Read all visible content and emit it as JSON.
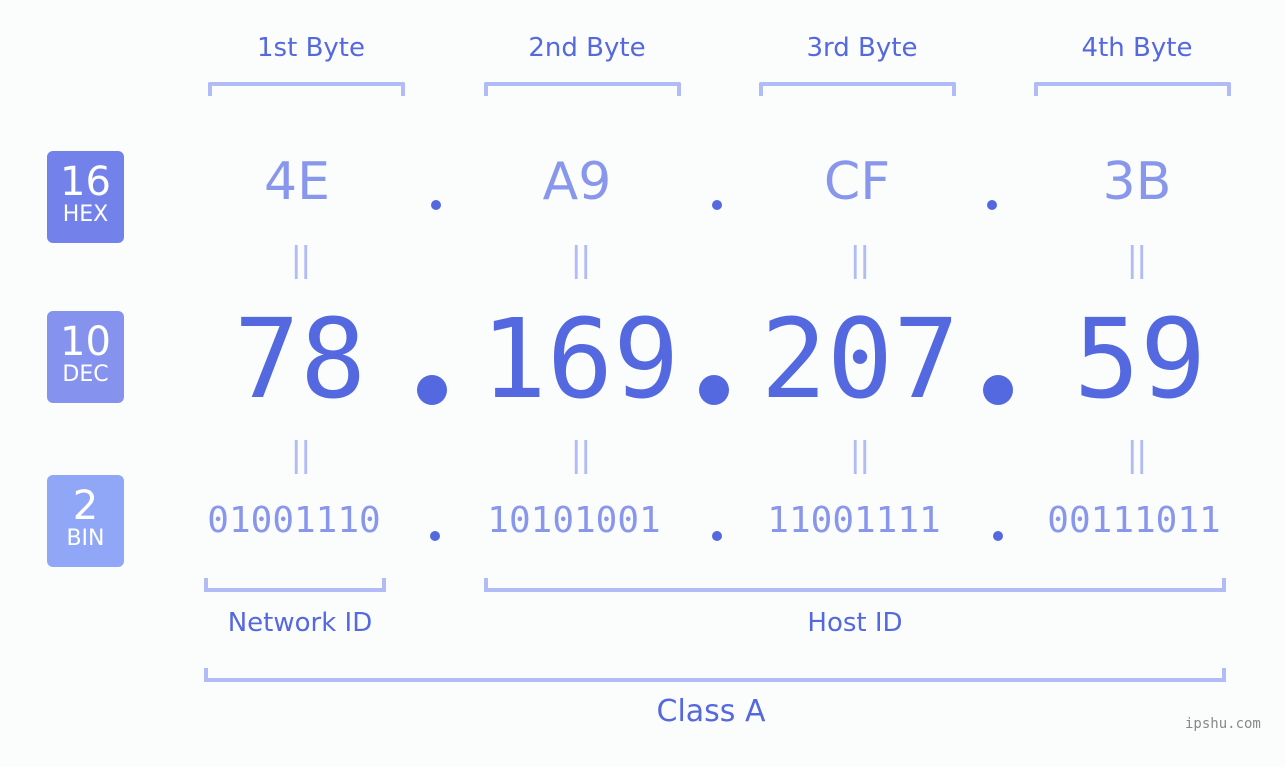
{
  "byte_headers": [
    "1st Byte",
    "2nd Byte",
    "3rd Byte",
    "4th Byte"
  ],
  "badges": {
    "hex": {
      "number": "16",
      "label": "HEX",
      "color": "#7282ea"
    },
    "dec": {
      "number": "10",
      "label": "DEC",
      "color": "#8593ee"
    },
    "bin": {
      "number": "2",
      "label": "BIN",
      "color": "#90a6f6"
    }
  },
  "hex_values": [
    "4E",
    "A9",
    "CF",
    "3B"
  ],
  "dec_values": [
    "78",
    "169",
    "207",
    "59"
  ],
  "bin_values": [
    "01001110",
    "10101001",
    "11001111",
    "00111011"
  ],
  "equals_symbol": "||",
  "network_id_label": "Network ID",
  "host_id_label": "Host ID",
  "class_label": "Class A",
  "watermark": "ipshu.com",
  "colors": {
    "primary": "#5468e0",
    "light": "#8896ec",
    "bracket": "#b1bbf6"
  }
}
